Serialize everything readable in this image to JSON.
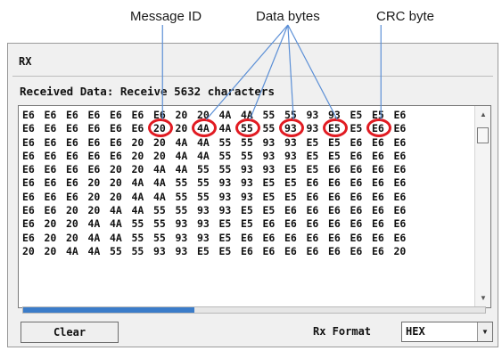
{
  "annotations": {
    "message_id": "Message ID",
    "data_bytes": "Data bytes",
    "crc_byte": "CRC byte",
    "color": "#e11b22",
    "pointer_color": "#5b8fd6"
  },
  "panel": {
    "title": "RX",
    "received_label": "Received Data: Receive 5632 characters"
  },
  "hex_rows": [
    [
      "E6",
      "E6",
      "E6",
      "E6",
      "E6",
      "E6",
      "E6",
      "20",
      "20",
      "4A",
      "4A",
      "55",
      "55",
      "93",
      "93",
      "E5",
      "E5",
      "E6"
    ],
    [
      "E6",
      "E6",
      "E6",
      "E6",
      "E6",
      "E6",
      "20",
      "20",
      "4A",
      "4A",
      "55",
      "55",
      "93",
      "93",
      "E5",
      "E5",
      "E6",
      "E6"
    ],
    [
      "E6",
      "E6",
      "E6",
      "E6",
      "E6",
      "20",
      "20",
      "4A",
      "4A",
      "55",
      "55",
      "93",
      "93",
      "E5",
      "E5",
      "E6",
      "E6",
      "E6"
    ],
    [
      "E6",
      "E6",
      "E6",
      "E6",
      "E6",
      "20",
      "20",
      "4A",
      "4A",
      "55",
      "55",
      "93",
      "93",
      "E5",
      "E5",
      "E6",
      "E6",
      "E6"
    ],
    [
      "E6",
      "E6",
      "E6",
      "E6",
      "20",
      "20",
      "4A",
      "4A",
      "55",
      "55",
      "93",
      "93",
      "E5",
      "E5",
      "E6",
      "E6",
      "E6",
      "E6"
    ],
    [
      "E6",
      "E6",
      "E6",
      "20",
      "20",
      "4A",
      "4A",
      "55",
      "55",
      "93",
      "93",
      "E5",
      "E5",
      "E6",
      "E6",
      "E6",
      "E6",
      "E6"
    ],
    [
      "E6",
      "E6",
      "E6",
      "20",
      "20",
      "4A",
      "4A",
      "55",
      "55",
      "93",
      "93",
      "E5",
      "E5",
      "E6",
      "E6",
      "E6",
      "E6",
      "E6"
    ],
    [
      "E6",
      "E6",
      "20",
      "20",
      "4A",
      "4A",
      "55",
      "55",
      "93",
      "93",
      "E5",
      "E5",
      "E6",
      "E6",
      "E6",
      "E6",
      "E6",
      "E6"
    ],
    [
      "E6",
      "20",
      "20",
      "4A",
      "4A",
      "55",
      "55",
      "93",
      "93",
      "E5",
      "E5",
      "E6",
      "E6",
      "E6",
      "E6",
      "E6",
      "E6",
      "E6"
    ],
    [
      "E6",
      "20",
      "20",
      "4A",
      "4A",
      "55",
      "55",
      "93",
      "93",
      "E5",
      "E6",
      "E6",
      "E6",
      "E6",
      "E6",
      "E6",
      "E6",
      "E6"
    ],
    [
      "20",
      "20",
      "4A",
      "4A",
      "55",
      "55",
      "93",
      "93",
      "E5",
      "E5",
      "E6",
      "E6",
      "E6",
      "E6",
      "E6",
      "E6",
      "E6",
      "20"
    ]
  ],
  "circled_cells": [
    {
      "row": 1,
      "col": 6,
      "role": "message-id"
    },
    {
      "row": 1,
      "col": 8,
      "role": "data-byte"
    },
    {
      "row": 1,
      "col": 10,
      "role": "data-byte"
    },
    {
      "row": 1,
      "col": 12,
      "role": "data-byte"
    },
    {
      "row": 1,
      "col": 14,
      "role": "data-byte"
    },
    {
      "row": 1,
      "col": 16,
      "role": "crc-byte"
    }
  ],
  "progress": 0.37,
  "buttons": {
    "clear": "Clear"
  },
  "rx_format": {
    "label": "Rx Format",
    "value": "HEX"
  },
  "icons": {
    "scroll_up": "scroll-up-arrow-icon",
    "scroll_down": "scroll-down-arrow-icon",
    "dropdown": "chevron-down-icon"
  }
}
